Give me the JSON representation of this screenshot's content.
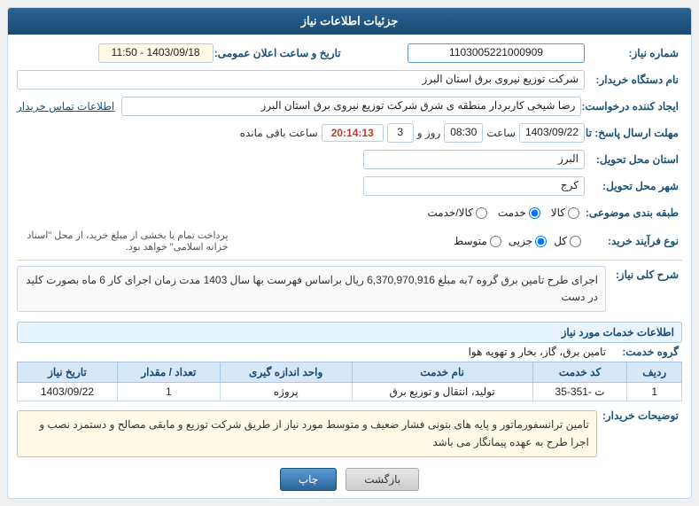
{
  "header": {
    "title": "جزئیات اطلاعات نیاز"
  },
  "fields": {
    "need_number_label": "شماره نیاز:",
    "need_number_value": "1103005221000909",
    "date_label": "تاریخ و ساعت اعلان عمومی:",
    "date_value": "1403/09/18 - 11:50",
    "buyer_label": "نام دستگاه خریدار:",
    "buyer_value": "شرکت توزیع نیروی برق استان البرز",
    "requester_label": "ایجاد کننده درخواست:",
    "requester_value": "رضا شیخی کاربردار منطقه ی شرق شرکت توزیع نیروی برق استان البرز",
    "requester_link": "اطلاعات تماس خریدار",
    "deadline_label": "مهلت ارسال پاسخ: تا",
    "deadline_date": "1403/09/22",
    "deadline_time_label": "ساعت",
    "deadline_time_value": "08:30",
    "days_label": "روز و",
    "days_value": "3",
    "remaining_label": "ساعت باقی مانده",
    "remaining_value": "20:14:13",
    "province_label": "استان محل تحویل:",
    "province_value": "البرز",
    "city_label": "شهر محل تحویل:",
    "city_value": "کرج",
    "category_label": "طبقه بندی موضوعی:",
    "category_options": [
      "کالا",
      "خدمت",
      "کالا/خدمت"
    ],
    "category_selected": "خدمت",
    "process_label": "نوع فرآیند خرید:",
    "process_options": [
      "کل",
      "جزیی",
      "متوسط"
    ],
    "process_selected": "جزیی",
    "payment_note": "پرداخت تمام یا بخشی از مبلغ خرید، از محل \"اسناد خزانه اسلامی\" خواهد بود."
  },
  "main_description": {
    "section_label": "شرح کلی نیاز:",
    "text": "اجرای طرح تامین برق گروه 7به مبلغ 6,370,970,916 ریال براساس فهرست بها سال 1403 مدت زمان اجرای کار 6 ماه بصورت کلید در دست"
  },
  "services_section": {
    "label": "اطلاعات خدمات مورد نیاز",
    "group_label": "گروه خدمت:",
    "group_value": "تامین برق، گاز، بخار و تهویه هوا",
    "table": {
      "columns": [
        "ردیف",
        "کد خدمت",
        "نام خدمت",
        "واحد اندازه گیری",
        "تعداد / مقدار",
        "تاریخ نیاز"
      ],
      "rows": [
        [
          "1",
          "ت -351-35",
          "تولید، انتقال و توزیع برق",
          "پروژه",
          "1",
          "1403/09/22"
        ]
      ]
    }
  },
  "buyer_notes_section": {
    "label": "توضیحات خریدار:",
    "text": "تامین ترانسفورماتور و پایه های بتونی فشار ضعیف و متوسط مورد نیاز از طریق شرکت توزیع و مابقی مصالح و دستمزد نصب و اجرا طرح به عهده پیمانگار می باشد"
  },
  "buttons": {
    "back_label": "بازگشت",
    "print_label": "چاپ"
  }
}
